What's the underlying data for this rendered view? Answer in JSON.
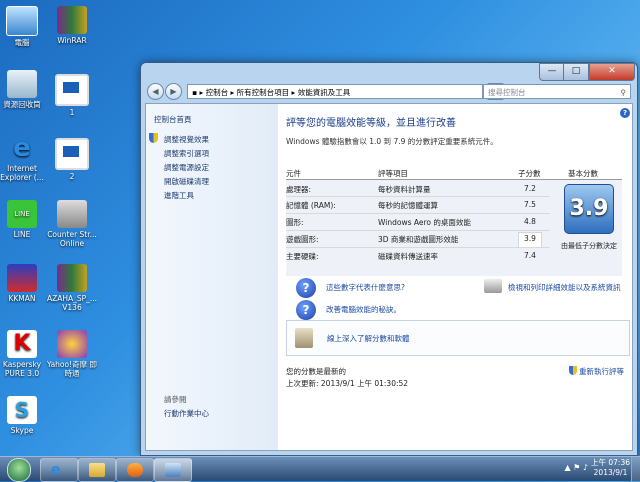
{
  "desktop": {
    "icons": [
      {
        "label": "電腦",
        "icon": "computer-icon"
      },
      {
        "label": "WinRAR",
        "icon": "winrar-icon"
      },
      {
        "label": "資源回收筒",
        "icon": "recycle-bin-icon"
      },
      {
        "label": "1",
        "icon": "monitor-shortcut-icon"
      },
      {
        "label": "Internet Explorer (...",
        "icon": "internet-explorer-icon"
      },
      {
        "label": "2",
        "icon": "monitor-shortcut-icon"
      },
      {
        "label": "LINE",
        "icon": "line-icon"
      },
      {
        "label": "Counter Str... Online",
        "icon": "counter-strike-icon"
      },
      {
        "label": "KKMAN",
        "icon": "kkman-icon"
      },
      {
        "label": "AZAHA_SP_... V136",
        "icon": "winrar-archive-icon"
      },
      {
        "label": "Kaspersky PURE 3.0",
        "icon": "kaspersky-icon"
      },
      {
        "label": "Yahoo!奇摩 即時通",
        "icon": "yahoo-messenger-icon"
      },
      {
        "label": "Skype",
        "icon": "skype-icon"
      }
    ]
  },
  "window": {
    "breadcrumb": [
      "控制台",
      "所有控制台項目",
      "效能資訊及工具"
    ],
    "search_placeholder": "搜尋控制台",
    "sidebar": {
      "home": "控制台首頁",
      "links": [
        "調整視覺效果",
        "調整索引選項",
        "調整電源設定",
        "開啟磁碟清理",
        "進階工具"
      ],
      "see_also_header": "請參閱",
      "see_also": [
        "行動作業中心"
      ]
    },
    "heading": "評等您的電腦效能等級，並且進行改善",
    "subtitle": "Windows 體驗指數會以 1.0 到 7.9 的分數評定重要系統元件。",
    "table": {
      "headers": {
        "component": "元件",
        "rated": "評等項目",
        "subscore": "子分數",
        "base": "基本分數"
      },
      "rows": [
        {
          "component": "處理器:",
          "rated": "每秒資料計算量",
          "subscore": "7.2"
        },
        {
          "component": "記憶體 (RAM):",
          "rated": "每秒的記憶體運算",
          "subscore": "7.5"
        },
        {
          "component": "圖形:",
          "rated": "Windows Aero 的桌面效能",
          "subscore": "4.8"
        },
        {
          "component": "遊戲圖形:",
          "rated": "3D 商業和遊戲圖形效能",
          "subscore": "3.9"
        },
        {
          "component": "主要硬碟:",
          "rated": "磁碟資料傳送速率",
          "subscore": "7.4"
        }
      ],
      "base_score": "3.9",
      "base_note": "由最低子分數決定"
    },
    "links": {
      "meaning": "這些數字代表什麼意思?",
      "improve": "改善電腦效能的秘訣。",
      "print": "檢視和列印詳細效能以及系統資訊"
    },
    "learn_more": "線上深入了解分數和軟體",
    "footer_status": "您的分數是最新的",
    "last_updated": "上次更新: 2013/9/1 上午 01:30:52",
    "rerun": "重新執行評等"
  },
  "taskbar": {
    "time": "上午 07:36",
    "date": "2013/9/1"
  }
}
